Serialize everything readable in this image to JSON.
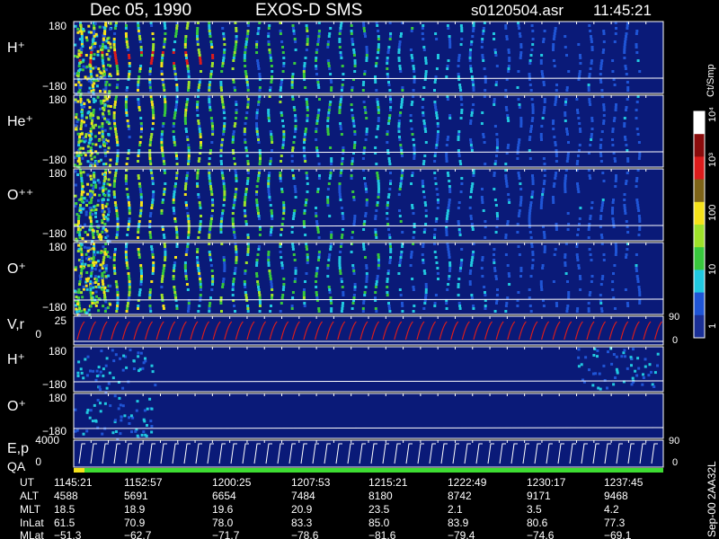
{
  "header": {
    "date": "Dec 05, 1990",
    "instrument": "EXOS-D SMS",
    "file": "s0120504.asr",
    "time": "11:45:21"
  },
  "colorbar": {
    "unit_label": "Ct/Smp",
    "ticks": [
      "1",
      "10",
      "100",
      "10³",
      "10⁴"
    ],
    "colors": [
      "#1a2f96",
      "#1f55d6",
      "#21c8e0",
      "#38c83d",
      "#9ee12a",
      "#f5e21a",
      "#7e6418",
      "#dc1c1c",
      "#8a0c0c",
      "#ffffff"
    ]
  },
  "panels": [
    {
      "id": "h-plus-1",
      "label": "H⁺",
      "ymax": "180",
      "ymin": "−180",
      "kind": "spectro",
      "ion": "h"
    },
    {
      "id": "he-plus",
      "label": "He⁺",
      "ymax": "180",
      "ymin": "−180",
      "kind": "spectro",
      "ion": "he"
    },
    {
      "id": "o-plus-plus",
      "label": "O⁺⁺",
      "ymax": "180",
      "ymin": "−180",
      "kind": "spectro",
      "ion": "opp"
    },
    {
      "id": "o-plus-1",
      "label": "O⁺",
      "ymax": "180",
      "ymin": "−180",
      "kind": "spectro",
      "ion": "op"
    },
    {
      "id": "vr",
      "label": "V,r",
      "ymax": "25",
      "ymin": "0",
      "right_top": "90",
      "right_bottom": "0",
      "kind": "sweep"
    },
    {
      "id": "h-plus-2",
      "label": "H⁺",
      "ymax": "180",
      "ymin": "−180",
      "kind": "sparse",
      "ion": "h2"
    },
    {
      "id": "o-plus-2",
      "label": "O⁺",
      "ymax": "180",
      "ymin": "−180",
      "kind": "sparse",
      "ion": "o2"
    },
    {
      "id": "ep",
      "label": "E,p",
      "ymax": "4000",
      "ymin": "0",
      "right_top": "90",
      "right_bottom": "0",
      "kind": "steps"
    }
  ],
  "qa_label": "QA",
  "side_label": "Sep-00  2AA32L",
  "table": {
    "row_labels": [
      "UT",
      "ALT",
      "MLT",
      "InLat",
      "MLat"
    ],
    "columns": [
      [
        "1145:21",
        "4588",
        "18.5",
        "61.5",
        "−51.3"
      ],
      [
        "1152:57",
        "5691",
        "18.9",
        "70.9",
        "−62.7"
      ],
      [
        "1200:25",
        "6654",
        "19.6",
        "78.0",
        "−71.7"
      ],
      [
        "1207:53",
        "7484",
        "20.9",
        "83.3",
        "−78.6"
      ],
      [
        "1215:21",
        "8180",
        "23.5",
        "85.0",
        "−81.6"
      ],
      [
        "1222:49",
        "8742",
        "2.1",
        "83.9",
        "−79.4"
      ],
      [
        "1230:17",
        "9171",
        "3.5",
        "80.6",
        "−74.6"
      ],
      [
        "1237:45",
        "9468",
        "4.2",
        "77.3",
        "−69.1"
      ]
    ]
  }
}
